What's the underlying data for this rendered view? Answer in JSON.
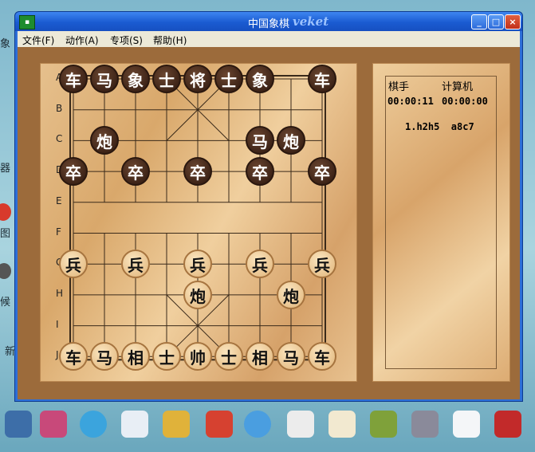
{
  "window": {
    "title": "中国象棋",
    "brand": "veket"
  },
  "title_buttons": {
    "minimize": "_",
    "maximize": "□",
    "close": "×"
  },
  "menu": [
    {
      "label": "文件(F)"
    },
    {
      "label": "动作(A)"
    },
    {
      "label": "专项(S)"
    },
    {
      "label": "帮助(H)"
    }
  ],
  "board": {
    "row_labels": [
      "A",
      "B",
      "C",
      "D",
      "E",
      "F",
      "G",
      "H",
      "I",
      "J"
    ],
    "pieces": [
      {
        "name": "车",
        "side": "black",
        "row": 0,
        "col": 0
      },
      {
        "name": "马",
        "side": "black",
        "row": 0,
        "col": 1
      },
      {
        "name": "象",
        "side": "black",
        "row": 0,
        "col": 2
      },
      {
        "name": "士",
        "side": "black",
        "row": 0,
        "col": 3
      },
      {
        "name": "将",
        "side": "black",
        "row": 0,
        "col": 4
      },
      {
        "name": "士",
        "side": "black",
        "row": 0,
        "col": 5
      },
      {
        "name": "象",
        "side": "black",
        "row": 0,
        "col": 6
      },
      {
        "name": "车",
        "side": "black",
        "row": 0,
        "col": 8
      },
      {
        "name": "炮",
        "side": "black",
        "row": 2,
        "col": 1
      },
      {
        "name": "马",
        "side": "black",
        "row": 2,
        "col": 6
      },
      {
        "name": "炮",
        "side": "black",
        "row": 2,
        "col": 7
      },
      {
        "name": "卒",
        "side": "black",
        "row": 3,
        "col": 0
      },
      {
        "name": "卒",
        "side": "black",
        "row": 3,
        "col": 2
      },
      {
        "name": "卒",
        "side": "black",
        "row": 3,
        "col": 4
      },
      {
        "name": "卒",
        "side": "black",
        "row": 3,
        "col": 6
      },
      {
        "name": "卒",
        "side": "black",
        "row": 3,
        "col": 8
      },
      {
        "name": "兵",
        "side": "red",
        "row": 6,
        "col": 0
      },
      {
        "name": "兵",
        "side": "red",
        "row": 6,
        "col": 2
      },
      {
        "name": "兵",
        "side": "red",
        "row": 6,
        "col": 4
      },
      {
        "name": "兵",
        "side": "red",
        "row": 6,
        "col": 6
      },
      {
        "name": "兵",
        "side": "red",
        "row": 6,
        "col": 8
      },
      {
        "name": "炮",
        "side": "red",
        "row": 7,
        "col": 4
      },
      {
        "name": "炮",
        "side": "red",
        "row": 7,
        "col": 7
      },
      {
        "name": "车",
        "side": "red",
        "row": 9,
        "col": 0
      },
      {
        "name": "马",
        "side": "red",
        "row": 9,
        "col": 1
      },
      {
        "name": "相",
        "side": "red",
        "row": 9,
        "col": 2
      },
      {
        "name": "士",
        "side": "red",
        "row": 9,
        "col": 3
      },
      {
        "name": "帅",
        "side": "red",
        "row": 9,
        "col": 4
      },
      {
        "name": "士",
        "side": "red",
        "row": 9,
        "col": 5
      },
      {
        "name": "相",
        "side": "red",
        "row": 9,
        "col": 6
      },
      {
        "name": "马",
        "side": "red",
        "row": 9,
        "col": 7
      },
      {
        "name": "车",
        "side": "red",
        "row": 9,
        "col": 8
      }
    ]
  },
  "side_panel": {
    "player_label": "棋手",
    "computer_label": "计算机",
    "player_time": "00:00:11",
    "computer_time": "00:00:00",
    "moves": "1.h2h5  a8c7"
  },
  "desktop": {
    "fragments": [
      "象",
      "器",
      "图",
      "候",
      "新"
    ]
  }
}
